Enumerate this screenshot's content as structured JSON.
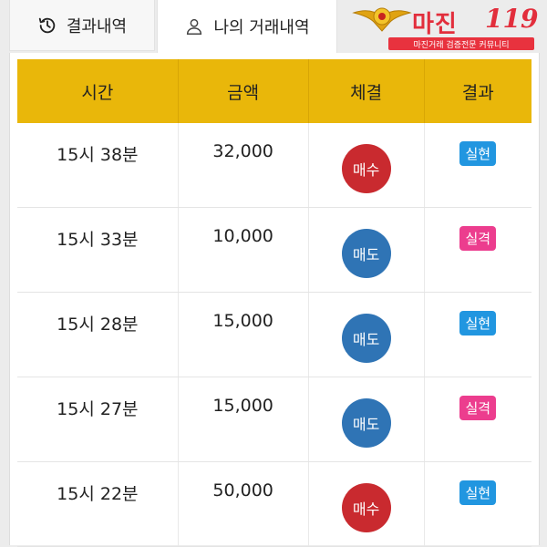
{
  "tabs": [
    {
      "label": "결과내역",
      "icon": "history-icon"
    },
    {
      "label": "나의 거래내역",
      "icon": "user-icon"
    }
  ],
  "logo": {
    "word": "마진",
    "number": "119",
    "subtitle": "마진거래 검증전문 커뮤니티"
  },
  "colors": {
    "header": "#e9b70a",
    "buy": "#c92a2f",
    "sell": "#2f74b5",
    "success": "#2196e0",
    "fail": "#ec3d8e"
  },
  "table": {
    "headers": [
      "시간",
      "금액",
      "체결",
      "결과"
    ],
    "rows": [
      {
        "time": "15시 38분",
        "amount": "32,000",
        "deal": "매수",
        "deal_type": "buy",
        "result": "실현",
        "result_type": "success"
      },
      {
        "time": "15시 33분",
        "amount": "10,000",
        "deal": "매도",
        "deal_type": "sell",
        "result": "실격",
        "result_type": "fail"
      },
      {
        "time": "15시 28분",
        "amount": "15,000",
        "deal": "매도",
        "deal_type": "sell",
        "result": "실현",
        "result_type": "success"
      },
      {
        "time": "15시 27분",
        "amount": "15,000",
        "deal": "매도",
        "deal_type": "sell",
        "result": "실격",
        "result_type": "fail"
      },
      {
        "time": "15시 22분",
        "amount": "50,000",
        "deal": "매수",
        "deal_type": "buy",
        "result": "실현",
        "result_type": "success"
      }
    ]
  }
}
